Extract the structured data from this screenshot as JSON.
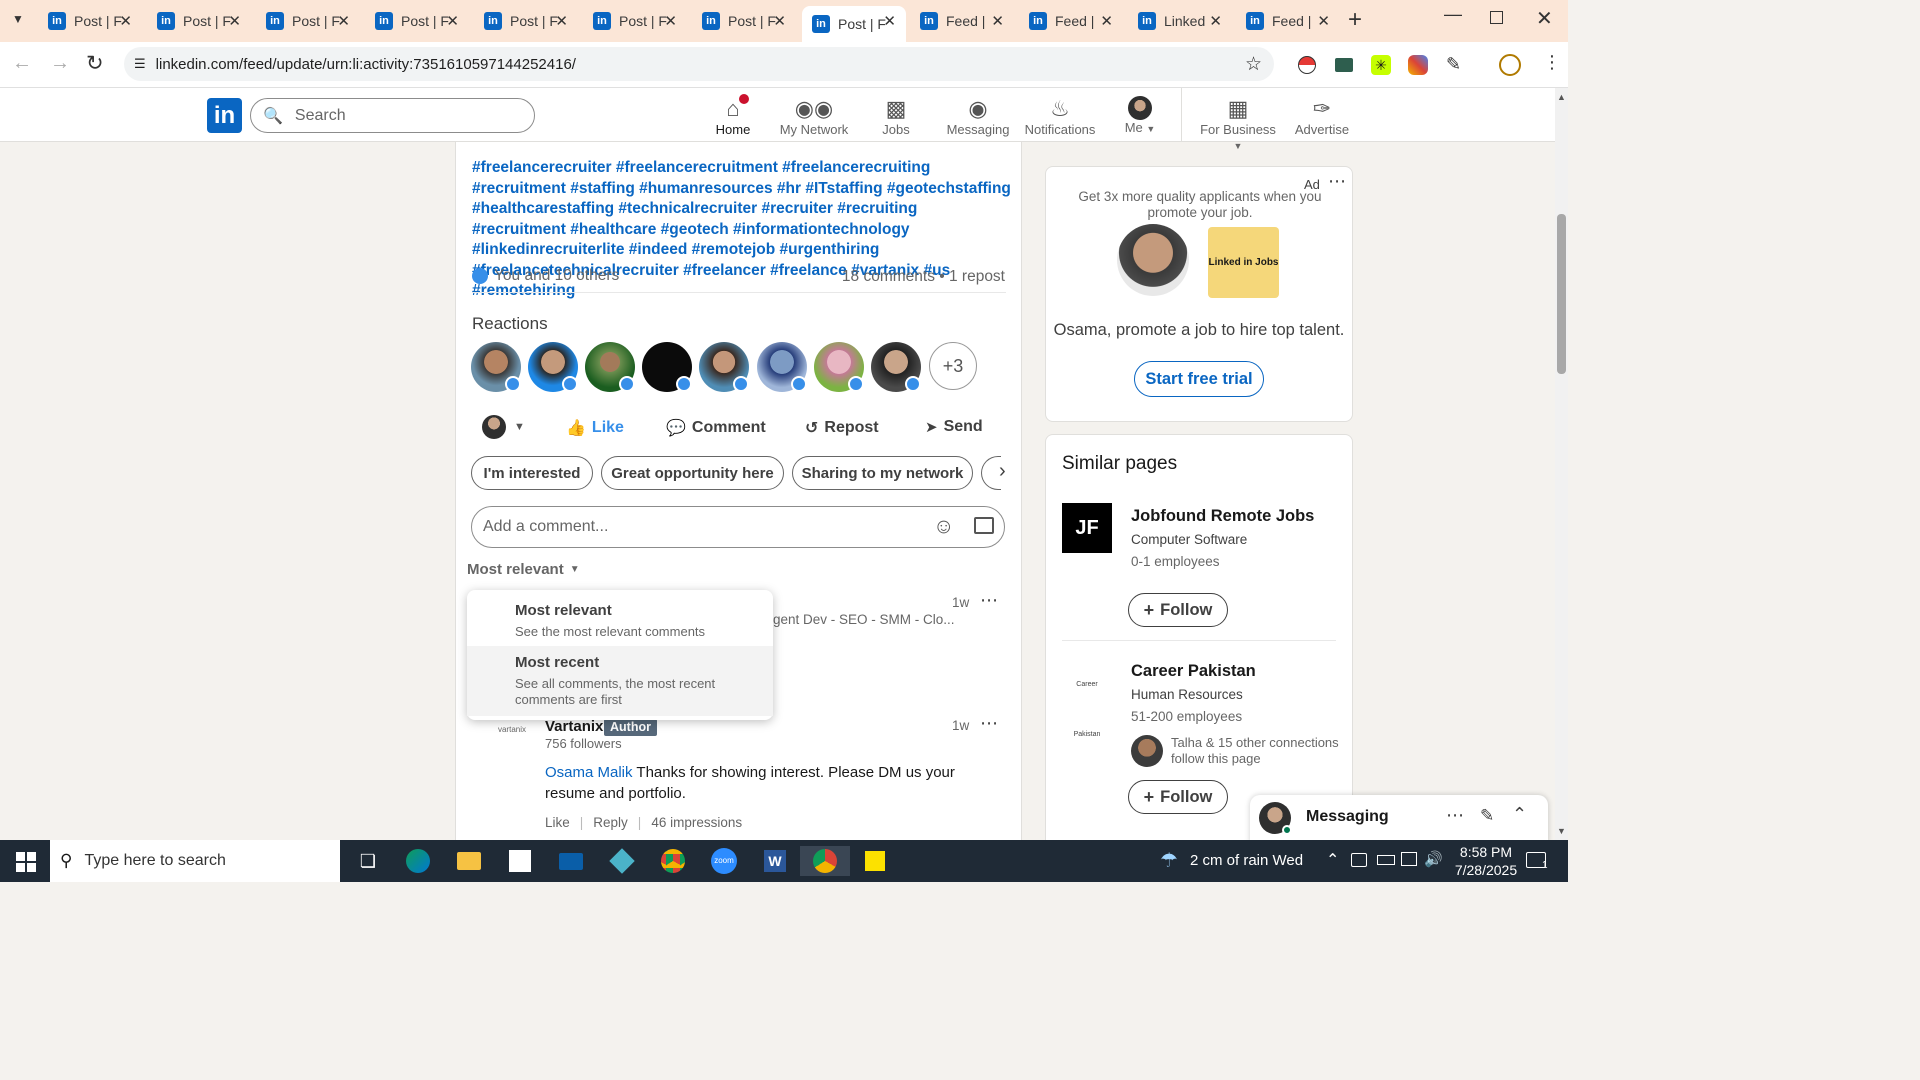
{
  "browser": {
    "tabs": [
      {
        "label": "Post | F",
        "favicon": "linkedin"
      },
      {
        "label": "Post | F",
        "favicon": "linkedin"
      },
      {
        "label": "Post | F",
        "favicon": "linkedin"
      },
      {
        "label": "Post | F",
        "favicon": "linkedin"
      },
      {
        "label": "Post | F",
        "favicon": "linkedin"
      },
      {
        "label": "Post | F",
        "favicon": "linkedin"
      },
      {
        "label": "Post | F",
        "favicon": "linkedin"
      },
      {
        "label": "Post | F",
        "favicon": "linkedin",
        "active": true
      },
      {
        "label": "Feed |",
        "favicon": "linkedin"
      },
      {
        "label": "Feed |",
        "favicon": "linkedin"
      },
      {
        "label": "Linked",
        "favicon": "linkedin"
      },
      {
        "label": "Feed |",
        "favicon": "linkedin"
      }
    ],
    "url": "linkedin.com/feed/update/urn:li:activity:7351610597144252416/"
  },
  "nav": {
    "search_placeholder": "Search",
    "items": [
      {
        "label": "Home",
        "icon": "home-icon",
        "badge": "1"
      },
      {
        "label": "My Network",
        "icon": "network-icon"
      },
      {
        "label": "Jobs",
        "icon": "briefcase-icon"
      },
      {
        "label": "Messaging",
        "icon": "chat-icon"
      },
      {
        "label": "Notifications",
        "icon": "bell-icon"
      },
      {
        "label": "Me",
        "icon": "avatar"
      },
      {
        "label": "For Business",
        "icon": "grid-icon"
      },
      {
        "label": "Advertise",
        "icon": "compass-icon"
      }
    ]
  },
  "post": {
    "hashtags": "#freelancerecruiter #freelancerecruitment #freelancerecruiting #recruitment #staffing #humanresources #hr #ITstaffing #geotechstaffing #healthcarestaffing #technicalrecruiter #recruiter #recruiting #recruitment #healthcare #geotech #informationtechnology #linkedinrecruiterlite #indeed #remotejob #urgenthiring #freelancetechnicalrecruiter #freelancer #freelance #vartanix #us #remotehiring",
    "reactions_summary": "You and 10 others",
    "counts": "18 comments • 1 repost",
    "reactions_title": "Reactions",
    "more_reactors": "+3",
    "actions": {
      "like": "Like",
      "comment": "Comment",
      "repost": "Repost",
      "send": "Send"
    },
    "suggestions": [
      "I'm interested",
      "Great opportunity here",
      "Sharing to my network"
    ],
    "comment_placeholder": "Add a comment...",
    "sort_label": "Most relevant"
  },
  "sort_menu": [
    {
      "title": "Most relevant",
      "desc": "See the most relevant comments"
    },
    {
      "title": "Most recent",
      "desc": "See all comments, the most recent comments are first"
    }
  ],
  "comments": [
    {
      "headline_fragment": "gent Dev - SEO - SMM - Clo...",
      "time": "1w"
    },
    {
      "author": "Vartanix",
      "badge": "Author",
      "followers": "756 followers",
      "time": "1w",
      "mention": "Osama Malik",
      "text": " Thanks for showing interest. Please DM us your resume and portfolio.",
      "like": "Like",
      "reply": "Reply",
      "impressions": "46 impressions"
    }
  ],
  "ad": {
    "label": "Ad",
    "text": "Get 3x more quality applicants when you promote your job.",
    "logo_text": "Linked in Jobs",
    "headline": "Osama, promote a job to hire top talent.",
    "cta": "Start free trial"
  },
  "similar": {
    "title": "Similar pages",
    "pages": [
      {
        "logo": "JF",
        "name": "Jobfound Remote Jobs",
        "industry": "Computer Software",
        "size": "0-1 employees",
        "follow": "Follow"
      },
      {
        "logo": "Career Pakistan",
        "name": "Career Pakistan",
        "industry": "Human Resources",
        "size": "51-200 employees",
        "connections": "Talha & 15 other connections follow this page",
        "follow": "Follow"
      }
    ]
  },
  "messaging": {
    "label": "Messaging"
  },
  "taskbar": {
    "search_placeholder": "Type here to search",
    "weather": "2 cm of rain Wed",
    "time": "8:58 PM",
    "date": "7/28/2025",
    "notif_count": "1"
  },
  "colors": {
    "brand": "#0a66c2",
    "tabbar": "#fbe6d7",
    "taskbar": "#1f2a36"
  }
}
